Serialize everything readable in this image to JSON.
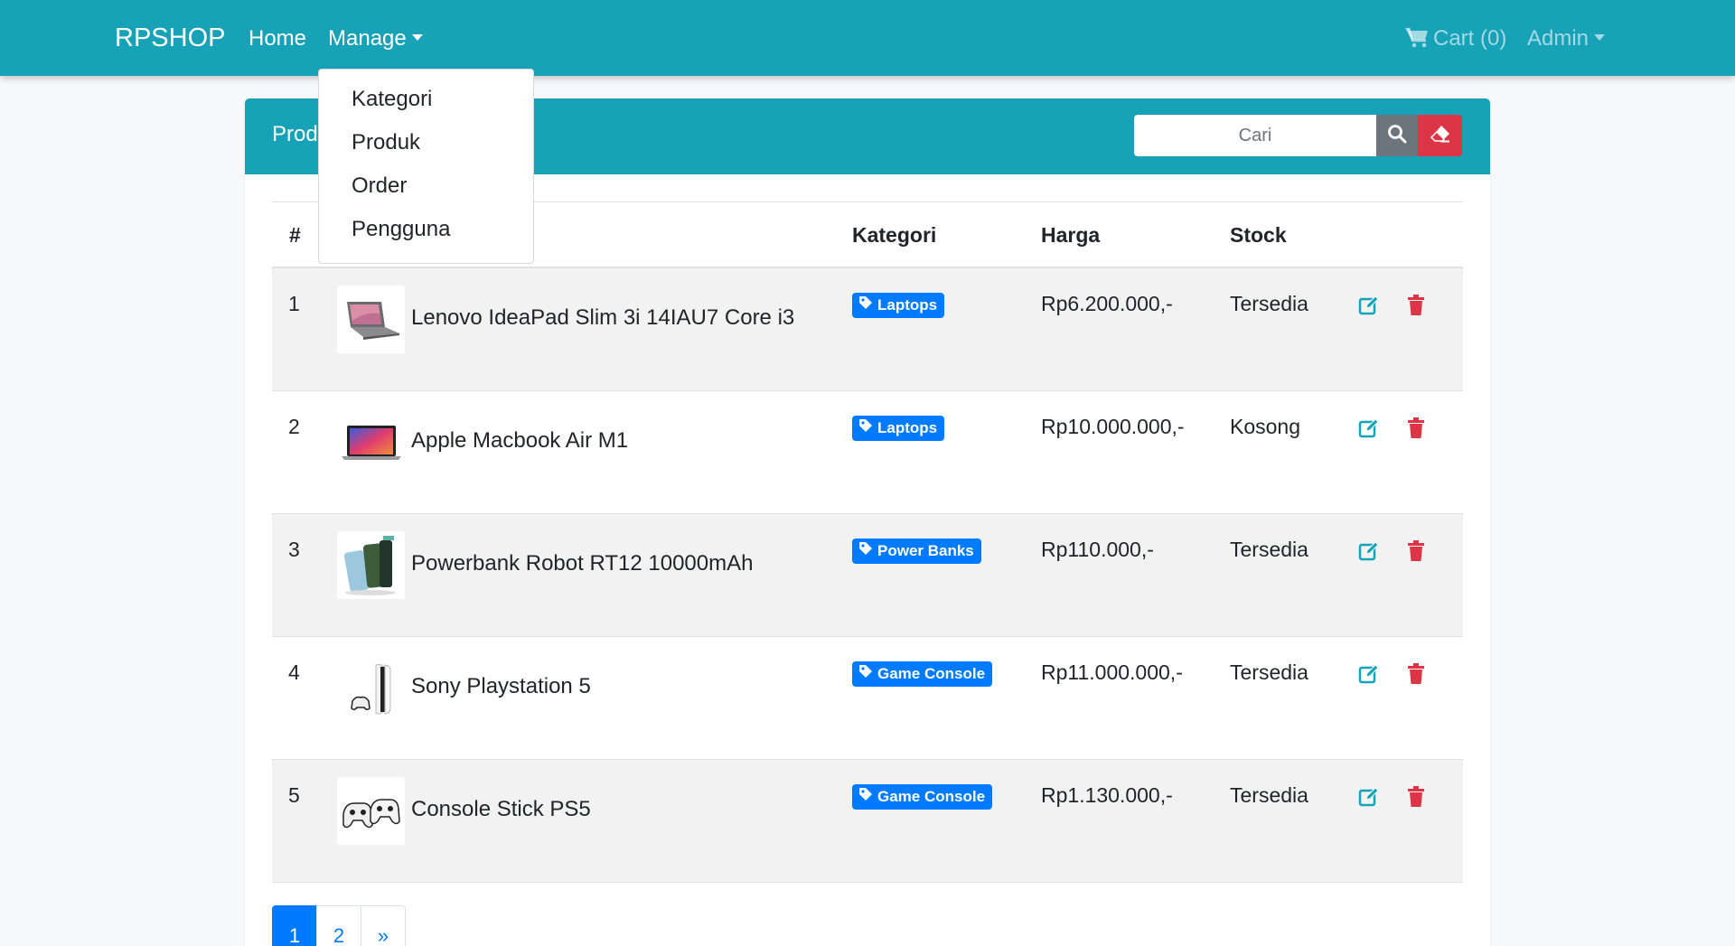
{
  "navbar": {
    "brand": "RPSHOP",
    "home": "Home",
    "manage": "Manage",
    "cart": "Cart (0)",
    "admin": "Admin"
  },
  "dropdown": {
    "items": [
      "Kategori",
      "Produk",
      "Order",
      "Pengguna"
    ]
  },
  "card": {
    "title": "Produk",
    "search_placeholder": "Cari"
  },
  "table": {
    "headers": [
      "#",
      "Kategori",
      "Harga",
      "Stock"
    ],
    "rows": [
      {
        "num": "1",
        "name": "Lenovo IdeaPad Slim 3i 14IAU7 Core i3",
        "category": "Laptops",
        "price": "Rp6.200.000,-",
        "stock": "Tersedia",
        "image": "laptop-gray"
      },
      {
        "num": "2",
        "name": "Apple Macbook Air M1",
        "category": "Laptops",
        "price": "Rp10.000.000,-",
        "stock": "Kosong",
        "image": "macbook"
      },
      {
        "num": "3",
        "name": "Powerbank Robot RT12 10000mAh",
        "category": "Power Banks",
        "price": "Rp110.000,-",
        "stock": "Tersedia",
        "image": "powerbank"
      },
      {
        "num": "4",
        "name": "Sony Playstation 5",
        "category": "Game Console",
        "price": "Rp11.000.000,-",
        "stock": "Tersedia",
        "image": "playstation"
      },
      {
        "num": "5",
        "name": "Console Stick PS5",
        "category": "Game Console",
        "price": "Rp1.130.000,-",
        "stock": "Tersedia",
        "image": "controller"
      }
    ]
  },
  "pagination": {
    "pages": [
      "1",
      "2",
      "»"
    ],
    "active": "1"
  },
  "colors": {
    "primary_bar": "#17a2b8",
    "badge": "#007bff",
    "edit": "#17a2b8",
    "delete": "#dc3545",
    "search_btn": "#6c757d",
    "clear_btn": "#dc3545"
  },
  "icons": {
    "cart": "shopping-cart-icon",
    "search": "search-icon",
    "clear": "eraser-icon",
    "badge": "tag-icon",
    "edit": "edit-icon",
    "delete": "trash-icon"
  }
}
